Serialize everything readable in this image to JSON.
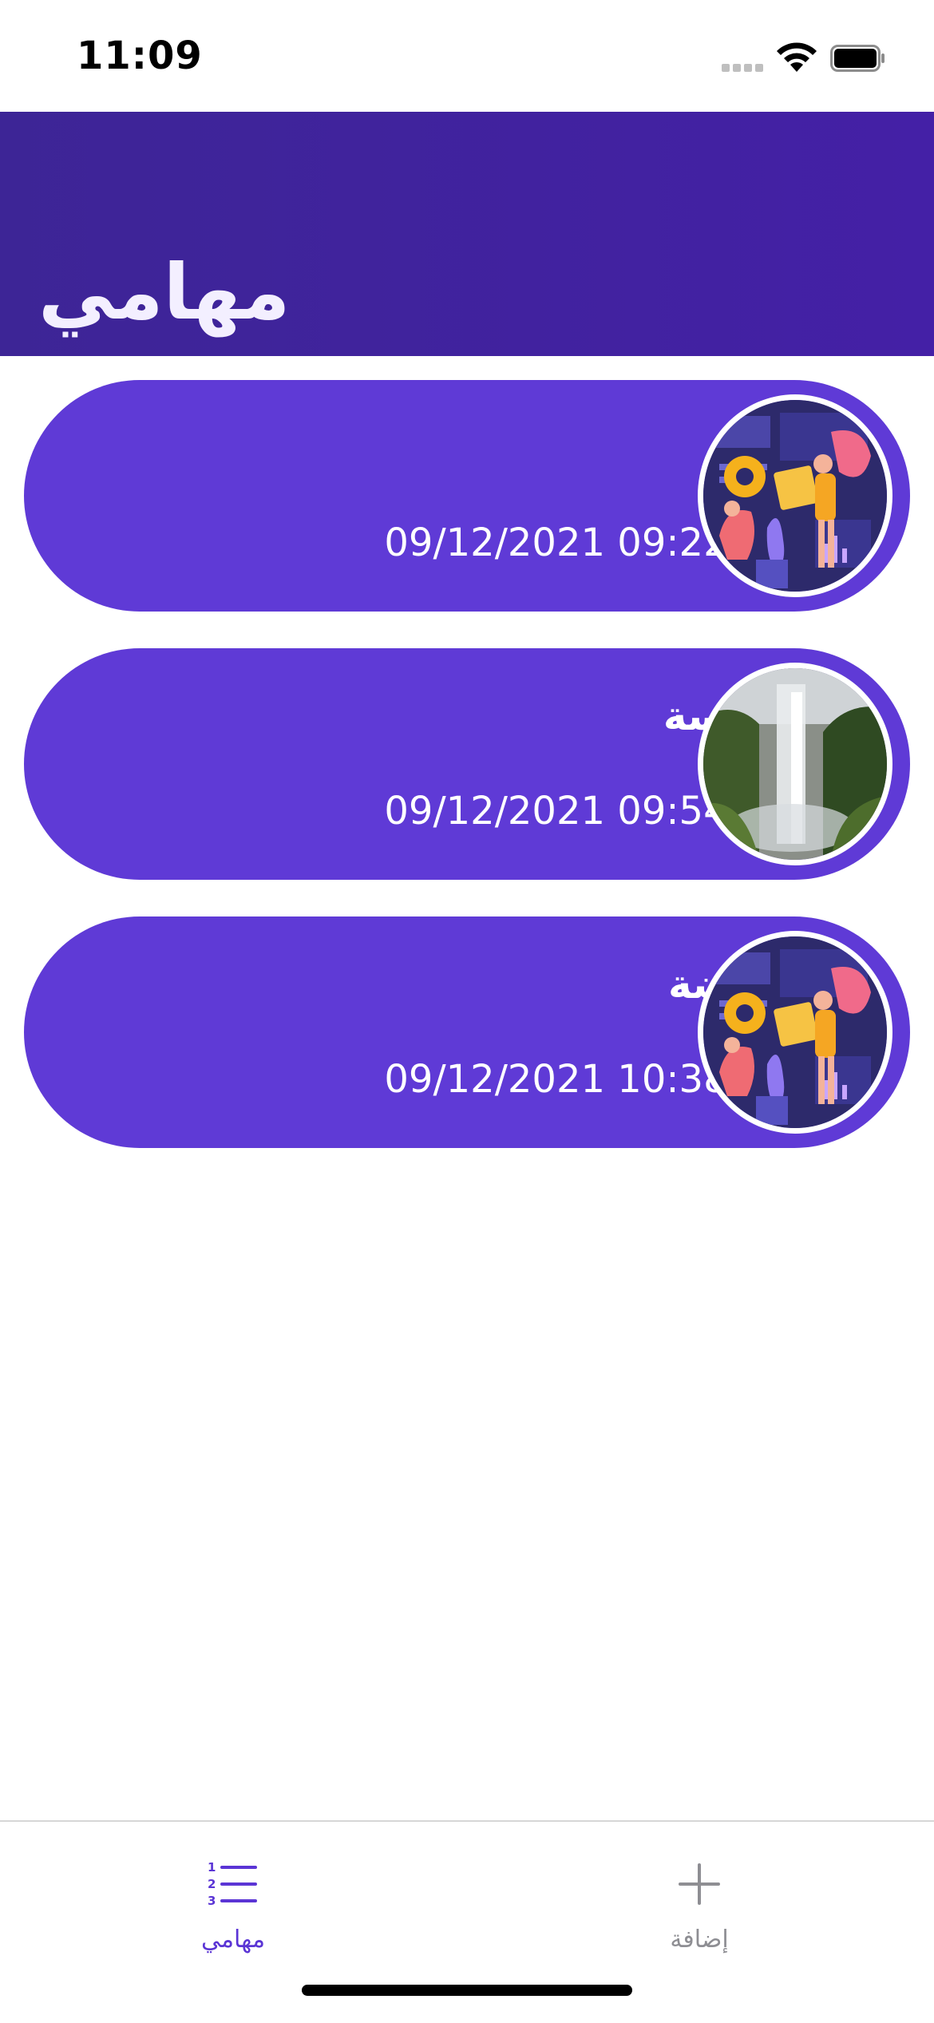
{
  "status_bar": {
    "time": "11:09"
  },
  "header": {
    "title": "مهامي"
  },
  "tasks": [
    {
      "title": "",
      "datetime": "09/12/2021 09:22PM",
      "image": "illustration-dashboard",
      "emoji": "technologist-emoji-icon"
    },
    {
      "title": "دراسة",
      "datetime": "09/12/2021 09:54PM",
      "image": "waterfall-photo"
    },
    {
      "title": "رياضة",
      "datetime": "09/12/2021 10:38PM",
      "image": "illustration-dashboard"
    }
  ],
  "tabbar": {
    "tabs": [
      {
        "label": "مهامي",
        "icon": "numbered-list-icon",
        "active": true
      },
      {
        "label": "إضافة",
        "icon": "plus-icon",
        "active": false
      }
    ]
  },
  "colors": {
    "header": "#4222a0",
    "card": "#5f3ad6",
    "accent": "#5b35d5",
    "inactive": "#8e8e93"
  }
}
